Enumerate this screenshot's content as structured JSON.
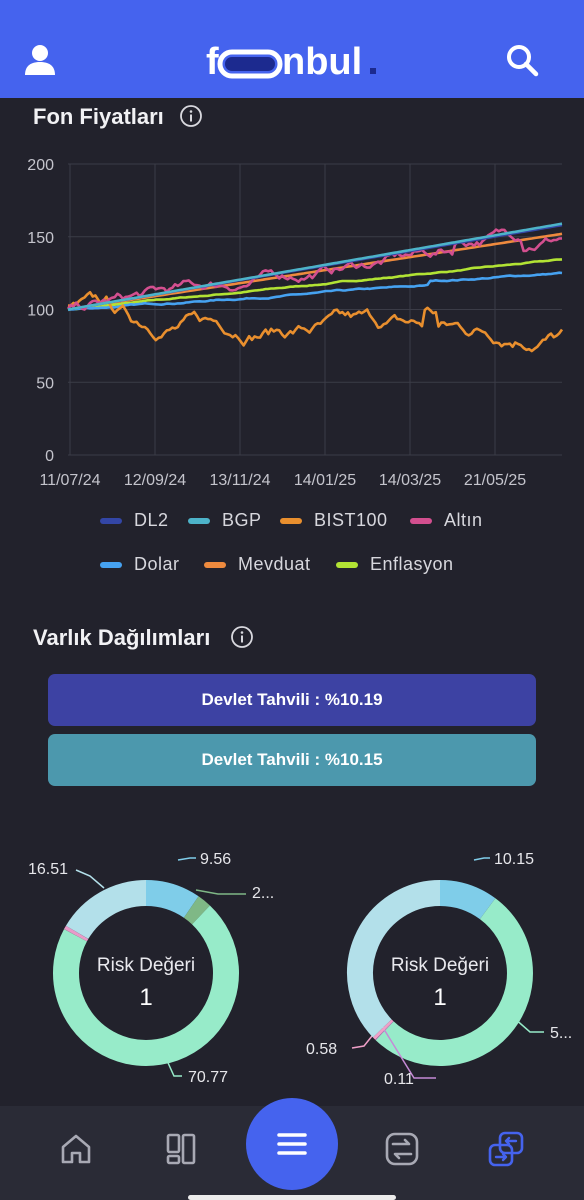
{
  "header": {
    "logo_text": "fonbul.",
    "colors": {
      "bar": "#4563ee",
      "logo_o": "#1c2a8f"
    }
  },
  "fund_prices": {
    "title": "Fon Fiyatları",
    "info_icon": "info-circle-icon"
  },
  "chart_data": {
    "type": "line",
    "ylim": [
      0,
      200
    ],
    "yticks": [
      0,
      50,
      100,
      150,
      200
    ],
    "x_tick_labels": [
      "11/07/24",
      "12/09/24",
      "13/11/24",
      "14/01/25",
      "14/03/25",
      "21/05/25"
    ],
    "grid": true,
    "legend_placement": "bottom",
    "series": [
      {
        "name": "DL2",
        "color": "#3346a6",
        "start": 100,
        "end": 158,
        "noise": 0
      },
      {
        "name": "BGP",
        "color": "#4db3c9",
        "start": 100,
        "end": 159,
        "noise": 0
      },
      {
        "name": "BIST100",
        "color": "#e98f2e",
        "start": 100,
        "end": 92,
        "noise": 4
      },
      {
        "name": "Altın",
        "color": "#d34f8f",
        "start": 100,
        "end": 152,
        "noise": 3
      },
      {
        "name": "Dolar",
        "color": "#46a2f1",
        "start": 100,
        "end": 122,
        "noise": 0.4
      },
      {
        "name": "Mevduat",
        "color": "#ee8a3e",
        "start": 100,
        "end": 152,
        "noise": 0
      },
      {
        "name": "Enflasyon",
        "color": "#b2e334",
        "start": 100,
        "end": 134,
        "noise": 0.3
      }
    ]
  },
  "asset_allocation": {
    "title": "Varlık Dağılımları",
    "info_icon": "info-circle-icon",
    "bars": [
      {
        "label": "Devlet Tahvili  : %10.19",
        "color": "#3d42a3"
      },
      {
        "label": "Devlet Tahvili  : %10.15",
        "color": "#4c98ad"
      }
    ]
  },
  "donuts": [
    {
      "center_title": "Risk Değeri",
      "center_value": "1",
      "segments": [
        {
          "value": 9.56,
          "label": "9.56",
          "color": "#7fcde9"
        },
        {
          "value": 2.5,
          "label": "2...",
          "color": "#7fb886"
        },
        {
          "value": 70.77,
          "label": "70.77",
          "color": "#97ebc9"
        },
        {
          "value": 0.66,
          "label": "",
          "color": "#e99bc9"
        },
        {
          "value": 16.51,
          "label": "16.51",
          "color": "#b3e0ea"
        }
      ]
    },
    {
      "center_title": "Risk Değeri",
      "center_value": "1",
      "segments": [
        {
          "value": 10.15,
          "label": "10.15",
          "color": "#7fcde9"
        },
        {
          "value": 52.0,
          "label": "5...",
          "color": "#97ebc9"
        },
        {
          "value": 0.11,
          "label": "0.11",
          "color": "#c58ad6"
        },
        {
          "value": 0.58,
          "label": "0.58",
          "color": "#f0a0c8"
        },
        {
          "value": 37.16,
          "label": "",
          "color": "#b3e0ea"
        }
      ]
    }
  ],
  "bottom_nav": {
    "items": [
      "home-icon",
      "dashboard-icon",
      "menu-icon",
      "compare-icon",
      "swap-icon"
    ],
    "active_color": "#4563ee"
  }
}
